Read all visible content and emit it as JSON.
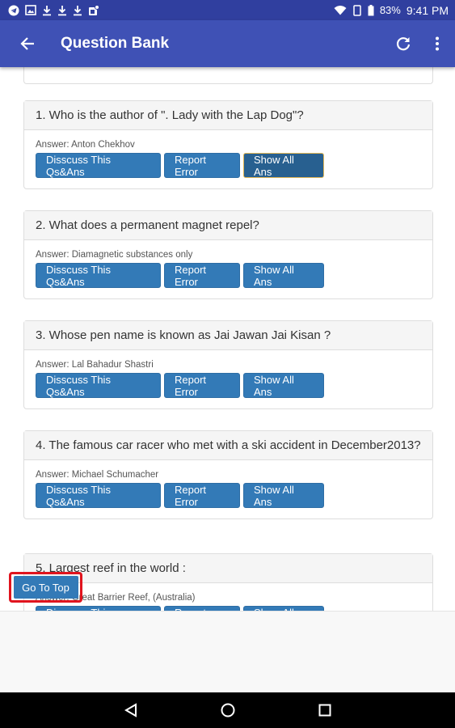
{
  "status_bar": {
    "left_icons": [
      "telegram-icon",
      "image-icon",
      "download-icon",
      "download-icon",
      "download-icon",
      "app-notification-icon"
    ],
    "battery_percent": "83%",
    "time": "9:41 PM"
  },
  "app_bar": {
    "title": "Question Bank",
    "icons": [
      "back-arrow-icon",
      "refresh-icon",
      "more-vert-icon"
    ]
  },
  "buttons": {
    "discuss": "Disscuss This Qs&Ans",
    "report": "Report Error",
    "show_all": "Show All Ans"
  },
  "questions": [
    {
      "q": "1. Who is the author of \". Lady with the Lap Dog\"?",
      "a": "Answer: Anton Chekhov"
    },
    {
      "q": "2. What does a permanent magnet repel?",
      "a": "Answer: Diamagnetic substances only"
    },
    {
      "q": "3. Whose pen name is known as Jai Jawan Jai Kisan ?",
      "a": "Answer: Lal Bahadur Shastri"
    },
    {
      "q": "4. The famous car racer who met with a ski accident in December2013?",
      "a": "Answer: Michael Schumacher"
    },
    {
      "q": "5. Largest reef in the world :",
      "a": "Answer: Great Barrier Reef, (Australia)"
    }
  ],
  "go_to_top": "Go To Top",
  "colors": {
    "status_bar": "#303f9f",
    "app_bar": "#3f51b5",
    "button": "#337ab7",
    "highlight": "#e0141e"
  }
}
